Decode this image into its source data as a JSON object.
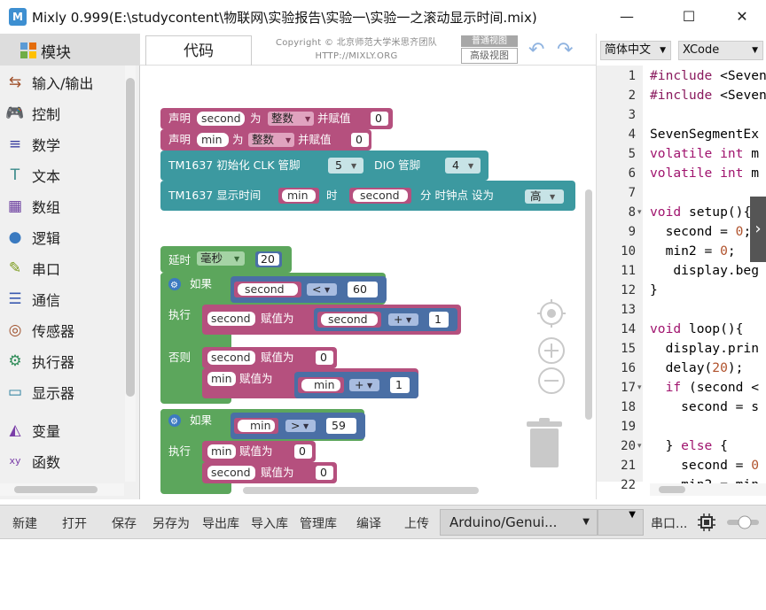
{
  "window": {
    "title": "Mixly 0.999(E:\\studycontent\\物联网\\实验报告\\实验一\\实验一之滚动显示时间.mix)",
    "app_icon_label": "M",
    "minimize_glyph": "—",
    "maximize_glyph": "☐",
    "close_glyph": "✕"
  },
  "sidebar": {
    "header": "模块",
    "items": [
      {
        "label": "输入/输出",
        "icon": "input-output-icon",
        "glyph": "⇆",
        "color": "#a0522d"
      },
      {
        "label": "控制",
        "icon": "gamepad-icon",
        "glyph": "🎮",
        "color": "#4d9e52"
      },
      {
        "label": "数学",
        "icon": "math-icon",
        "glyph": "≡",
        "color": "#3b3fa0"
      },
      {
        "label": "文本",
        "icon": "text-icon",
        "glyph": "T",
        "color": "#3a8a8a"
      },
      {
        "label": "数组",
        "icon": "array-icon",
        "glyph": "▦",
        "color": "#6a3c9e"
      },
      {
        "label": "逻辑",
        "icon": "bulb-icon",
        "glyph": "●",
        "color": "#3a7ac0"
      },
      {
        "label": "串口",
        "icon": "serial-icon",
        "glyph": "✎",
        "color": "#7a9a1a"
      },
      {
        "label": "通信",
        "icon": "communication-icon",
        "glyph": "☰",
        "color": "#3a5ab0"
      },
      {
        "label": "传感器",
        "icon": "sensor-icon",
        "glyph": "◎",
        "color": "#a0522d"
      },
      {
        "label": "执行器",
        "icon": "actuator-icon",
        "glyph": "⚙",
        "color": "#2e8b57"
      },
      {
        "label": "显示器",
        "icon": "monitor-icon",
        "glyph": "▭",
        "color": "#2a7f9e"
      },
      {
        "label": "变量",
        "icon": "variable-icon",
        "glyph": "◭",
        "color": "#7a3ea8"
      },
      {
        "label": "函数",
        "icon": "function-icon",
        "glyph": "xy",
        "color": "#7a3ea8"
      }
    ]
  },
  "workspace": {
    "code_tab": "代码",
    "copyright_line1": "Copyright © 北京师范大学米思齐团队",
    "copyright_line2": "HTTP://MIXLY.ORG",
    "view_simple": "普通视图",
    "view_advanced": "高级视图",
    "undo_glyph": "↶",
    "redo_glyph": "↷"
  },
  "blocks": {
    "declare1": {
      "kw1": "声明",
      "var": "second",
      "kw2": "为",
      "type": "整数",
      "kw3": "并赋值",
      "value": "0"
    },
    "declare2": {
      "kw1": "声明",
      "var": "min",
      "kw2": "为",
      "type": "整数",
      "kw3": "并赋值",
      "value": "0"
    },
    "tm_init": {
      "label": "TM1637 初始化 CLK 管脚",
      "clk": "5",
      "dio_label": "DIO 管脚",
      "dio": "4"
    },
    "tm_show": {
      "label": "TM1637 显示时间",
      "hour": "min",
      "hour_label": "时",
      "minute": "second",
      "minute_label": "分 时钟点 设为",
      "colon": "高"
    },
    "delay": {
      "label": "延时",
      "unit": "毫秒",
      "value": "20"
    },
    "if1": {
      "if_label": "如果",
      "left": "second",
      "op": "<",
      "right": "60",
      "then_label": "执行",
      "then_var": "second",
      "then_assign": "赋值为",
      "then_expr_var": "second",
      "then_expr_op": "+",
      "then_expr_num": "1",
      "else_label": "否则",
      "else1_var": "second",
      "else1_assign": "赋值为",
      "else1_val": "0",
      "else2_var": "min",
      "else2_assign": "赋值为",
      "else2_expr_var": "min",
      "else2_expr_op": "+",
      "else2_expr_num": "1"
    },
    "if2": {
      "if_label": "如果",
      "left": "min",
      "op": ">",
      "right": "59",
      "then_label": "执行",
      "then1_var": "min",
      "then1_assign": "赋值为",
      "then1_val": "0",
      "then2_var": "second",
      "then2_assign": "赋值为",
      "then2_val": "0"
    }
  },
  "code_pane": {
    "language_select": "简体中文",
    "theme_select": "XCode",
    "lines": [
      {
        "n": "1",
        "segs": [
          [
            "pp",
            "#include"
          ],
          [
            "",
            " <Seven"
          ]
        ]
      },
      {
        "n": "2",
        "segs": [
          [
            "pp",
            "#include"
          ],
          [
            "",
            " <Seven"
          ]
        ]
      },
      {
        "n": "3",
        "segs": []
      },
      {
        "n": "4",
        "segs": [
          [
            "",
            "SevenSegmentEx"
          ]
        ]
      },
      {
        "n": "5",
        "segs": [
          [
            "kw",
            "volatile"
          ],
          [
            "",
            " "
          ],
          [
            "kw",
            "int"
          ],
          [
            "",
            " m"
          ]
        ]
      },
      {
        "n": "6",
        "segs": [
          [
            "kw",
            "volatile"
          ],
          [
            "",
            " "
          ],
          [
            "kw",
            "int"
          ],
          [
            "",
            " m"
          ]
        ]
      },
      {
        "n": "7",
        "segs": []
      },
      {
        "n": "8",
        "fold": "▾",
        "segs": [
          [
            "kw",
            "void"
          ],
          [
            "",
            " setup(){"
          ]
        ]
      },
      {
        "n": "9",
        "segs": [
          [
            "",
            "  second = "
          ],
          [
            "num",
            "0"
          ],
          [
            "",
            ";"
          ]
        ]
      },
      {
        "n": "10",
        "segs": [
          [
            "",
            "  min2 = "
          ],
          [
            "num",
            "0"
          ],
          [
            "",
            ";"
          ]
        ]
      },
      {
        "n": "11",
        "segs": [
          [
            "",
            "   display.beg"
          ]
        ]
      },
      {
        "n": "12",
        "segs": [
          [
            "",
            "}"
          ]
        ]
      },
      {
        "n": "13",
        "segs": []
      },
      {
        "n": "14",
        "segs": [
          [
            "kw",
            "void"
          ],
          [
            "",
            " loop(){"
          ]
        ]
      },
      {
        "n": "15",
        "segs": [
          [
            "",
            "  display.prin"
          ]
        ]
      },
      {
        "n": "16",
        "segs": [
          [
            "",
            "  delay("
          ],
          [
            "num",
            "20"
          ],
          [
            "",
            ");"
          ]
        ]
      },
      {
        "n": "17",
        "fold": "▾",
        "segs": [
          [
            "",
            "  "
          ],
          [
            "kw",
            "if"
          ],
          [
            "",
            " (second <"
          ]
        ]
      },
      {
        "n": "18",
        "segs": [
          [
            "",
            "    second = s"
          ]
        ]
      },
      {
        "n": "19",
        "segs": []
      },
      {
        "n": "20",
        "fold": "▾",
        "segs": [
          [
            "",
            "  } "
          ],
          [
            "kw",
            "else"
          ],
          [
            "",
            " {"
          ]
        ]
      },
      {
        "n": "21",
        "segs": [
          [
            "",
            "    second = "
          ],
          [
            "num",
            "0"
          ]
        ]
      },
      {
        "n": "22",
        "segs": [
          [
            "",
            "    min2 = min"
          ]
        ]
      }
    ]
  },
  "toolbar": {
    "new": "新建",
    "open": "打开",
    "save": "保存",
    "save_as": "另存为",
    "export_lib": "导出库",
    "import_lib": "导入库",
    "manage_lib": "管理库",
    "compile": "编译",
    "upload": "上传",
    "board": "Arduino/Genui...",
    "serial": "串口..."
  }
}
